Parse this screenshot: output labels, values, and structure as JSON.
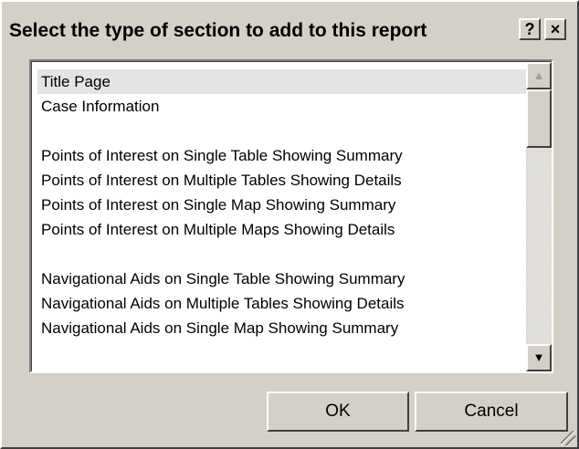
{
  "dialog": {
    "title": "Select the type of section to add to this report",
    "help_glyph": "?",
    "close_glyph": "×"
  },
  "list": {
    "items": [
      "Title Page",
      "Case Information",
      "",
      "Points of Interest on Single Table Showing Summary",
      "Points of Interest on Multiple Tables Showing Details",
      "Points of Interest on Single Map Showing Summary",
      "Points of Interest on Multiple Maps Showing Details",
      "",
      "Navigational Aids on Single Table Showing Summary",
      "Navigational Aids on Multiple Tables Showing Details",
      "Navigational Aids on Single Map Showing Summary"
    ],
    "selected_index": 0
  },
  "scrollbar": {
    "up_glyph": "▲",
    "down_glyph": "▼"
  },
  "buttons": {
    "ok_label": "OK",
    "cancel_label": "Cancel"
  }
}
